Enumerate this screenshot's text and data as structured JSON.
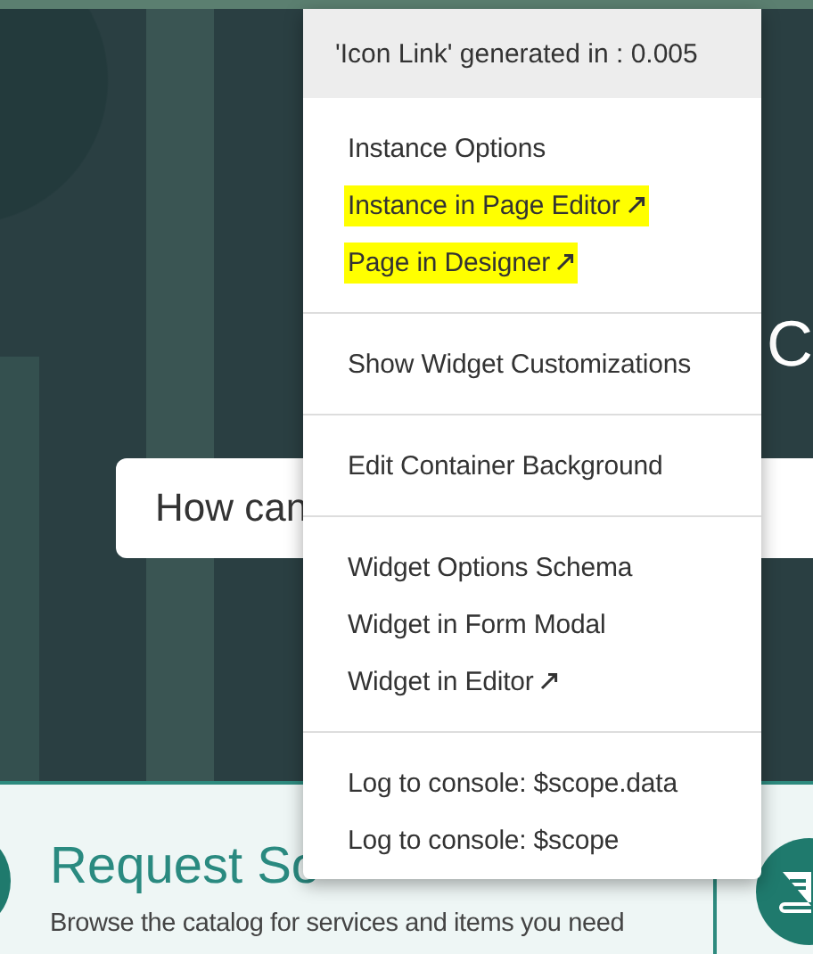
{
  "hero": {
    "heading": "C",
    "search": {
      "placeholder": "How can"
    }
  },
  "card": {
    "title": "Request So",
    "description": "Browse the catalog for services and items you need"
  },
  "menu": {
    "header": "'Icon Link' generated in : 0.005",
    "sections": [
      {
        "items": [
          {
            "label": "Instance Options",
            "highlighted": false,
            "external": false
          },
          {
            "label": "Instance in Page Editor",
            "highlighted": true,
            "external": true
          },
          {
            "label": "Page in Designer",
            "highlighted": true,
            "external": true
          }
        ]
      },
      {
        "items": [
          {
            "label": "Show Widget Customizations",
            "highlighted": false,
            "external": false
          }
        ]
      },
      {
        "items": [
          {
            "label": "Edit Container Background",
            "highlighted": false,
            "external": false
          }
        ]
      },
      {
        "items": [
          {
            "label": "Widget Options Schema",
            "highlighted": false,
            "external": false
          },
          {
            "label": "Widget in Form Modal",
            "highlighted": false,
            "external": false
          },
          {
            "label": "Widget in Editor",
            "highlighted": false,
            "external": true
          }
        ]
      },
      {
        "items": [
          {
            "label": "Log to console: $scope.data",
            "highlighted": false,
            "external": false
          },
          {
            "label": "Log to console: $scope",
            "highlighted": false,
            "external": false
          }
        ]
      }
    ]
  }
}
